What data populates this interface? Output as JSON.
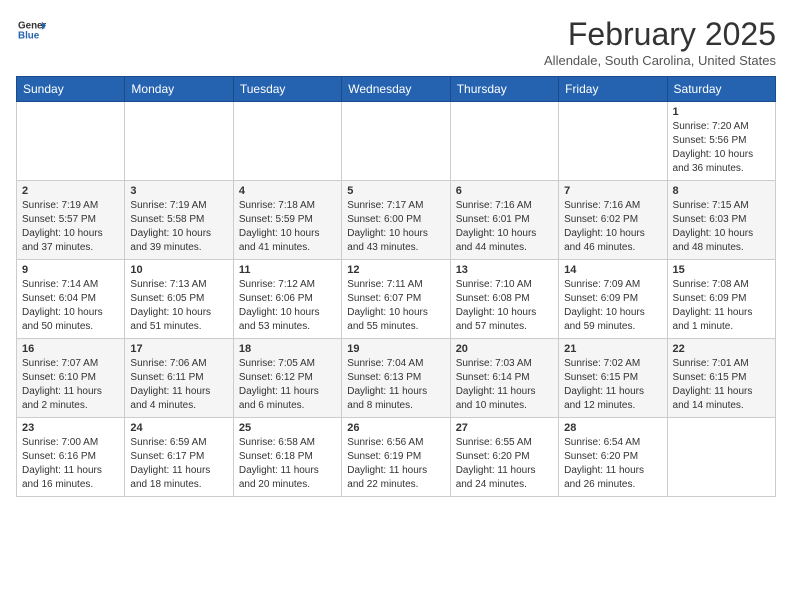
{
  "header": {
    "logo_general": "General",
    "logo_blue": "Blue",
    "month_title": "February 2025",
    "location": "Allendale, South Carolina, United States"
  },
  "days_of_week": [
    "Sunday",
    "Monday",
    "Tuesday",
    "Wednesday",
    "Thursday",
    "Friday",
    "Saturday"
  ],
  "weeks": [
    [
      {
        "day": "",
        "info": ""
      },
      {
        "day": "",
        "info": ""
      },
      {
        "day": "",
        "info": ""
      },
      {
        "day": "",
        "info": ""
      },
      {
        "day": "",
        "info": ""
      },
      {
        "day": "",
        "info": ""
      },
      {
        "day": "1",
        "info": "Sunrise: 7:20 AM\nSunset: 5:56 PM\nDaylight: 10 hours and 36 minutes."
      }
    ],
    [
      {
        "day": "2",
        "info": "Sunrise: 7:19 AM\nSunset: 5:57 PM\nDaylight: 10 hours and 37 minutes."
      },
      {
        "day": "3",
        "info": "Sunrise: 7:19 AM\nSunset: 5:58 PM\nDaylight: 10 hours and 39 minutes."
      },
      {
        "day": "4",
        "info": "Sunrise: 7:18 AM\nSunset: 5:59 PM\nDaylight: 10 hours and 41 minutes."
      },
      {
        "day": "5",
        "info": "Sunrise: 7:17 AM\nSunset: 6:00 PM\nDaylight: 10 hours and 43 minutes."
      },
      {
        "day": "6",
        "info": "Sunrise: 7:16 AM\nSunset: 6:01 PM\nDaylight: 10 hours and 44 minutes."
      },
      {
        "day": "7",
        "info": "Sunrise: 7:16 AM\nSunset: 6:02 PM\nDaylight: 10 hours and 46 minutes."
      },
      {
        "day": "8",
        "info": "Sunrise: 7:15 AM\nSunset: 6:03 PM\nDaylight: 10 hours and 48 minutes."
      }
    ],
    [
      {
        "day": "9",
        "info": "Sunrise: 7:14 AM\nSunset: 6:04 PM\nDaylight: 10 hours and 50 minutes."
      },
      {
        "day": "10",
        "info": "Sunrise: 7:13 AM\nSunset: 6:05 PM\nDaylight: 10 hours and 51 minutes."
      },
      {
        "day": "11",
        "info": "Sunrise: 7:12 AM\nSunset: 6:06 PM\nDaylight: 10 hours and 53 minutes."
      },
      {
        "day": "12",
        "info": "Sunrise: 7:11 AM\nSunset: 6:07 PM\nDaylight: 10 hours and 55 minutes."
      },
      {
        "day": "13",
        "info": "Sunrise: 7:10 AM\nSunset: 6:08 PM\nDaylight: 10 hours and 57 minutes."
      },
      {
        "day": "14",
        "info": "Sunrise: 7:09 AM\nSunset: 6:09 PM\nDaylight: 10 hours and 59 minutes."
      },
      {
        "day": "15",
        "info": "Sunrise: 7:08 AM\nSunset: 6:09 PM\nDaylight: 11 hours and 1 minute."
      }
    ],
    [
      {
        "day": "16",
        "info": "Sunrise: 7:07 AM\nSunset: 6:10 PM\nDaylight: 11 hours and 2 minutes."
      },
      {
        "day": "17",
        "info": "Sunrise: 7:06 AM\nSunset: 6:11 PM\nDaylight: 11 hours and 4 minutes."
      },
      {
        "day": "18",
        "info": "Sunrise: 7:05 AM\nSunset: 6:12 PM\nDaylight: 11 hours and 6 minutes."
      },
      {
        "day": "19",
        "info": "Sunrise: 7:04 AM\nSunset: 6:13 PM\nDaylight: 11 hours and 8 minutes."
      },
      {
        "day": "20",
        "info": "Sunrise: 7:03 AM\nSunset: 6:14 PM\nDaylight: 11 hours and 10 minutes."
      },
      {
        "day": "21",
        "info": "Sunrise: 7:02 AM\nSunset: 6:15 PM\nDaylight: 11 hours and 12 minutes."
      },
      {
        "day": "22",
        "info": "Sunrise: 7:01 AM\nSunset: 6:15 PM\nDaylight: 11 hours and 14 minutes."
      }
    ],
    [
      {
        "day": "23",
        "info": "Sunrise: 7:00 AM\nSunset: 6:16 PM\nDaylight: 11 hours and 16 minutes."
      },
      {
        "day": "24",
        "info": "Sunrise: 6:59 AM\nSunset: 6:17 PM\nDaylight: 11 hours and 18 minutes."
      },
      {
        "day": "25",
        "info": "Sunrise: 6:58 AM\nSunset: 6:18 PM\nDaylight: 11 hours and 20 minutes."
      },
      {
        "day": "26",
        "info": "Sunrise: 6:56 AM\nSunset: 6:19 PM\nDaylight: 11 hours and 22 minutes."
      },
      {
        "day": "27",
        "info": "Sunrise: 6:55 AM\nSunset: 6:20 PM\nDaylight: 11 hours and 24 minutes."
      },
      {
        "day": "28",
        "info": "Sunrise: 6:54 AM\nSunset: 6:20 PM\nDaylight: 11 hours and 26 minutes."
      },
      {
        "day": "",
        "info": ""
      }
    ]
  ]
}
